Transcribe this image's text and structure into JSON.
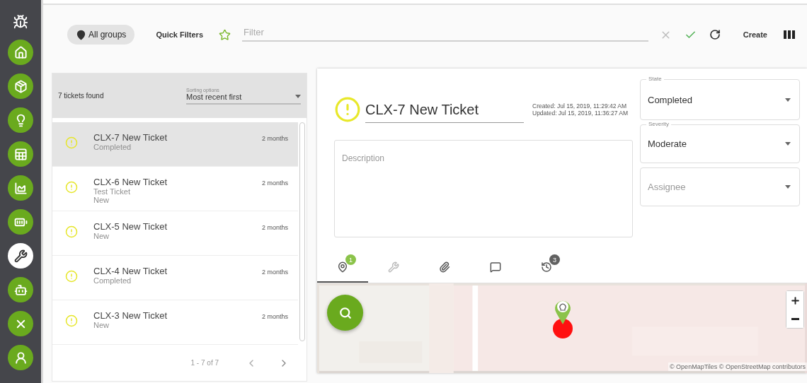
{
  "sidebar": {
    "items": [
      {
        "kind": "home",
        "selected": false
      },
      {
        "kind": "box",
        "selected": false
      },
      {
        "kind": "bulb",
        "selected": false
      },
      {
        "kind": "table",
        "selected": false
      },
      {
        "kind": "chart",
        "selected": false
      },
      {
        "kind": "battery",
        "selected": false
      },
      {
        "kind": "wrench",
        "selected": true
      },
      {
        "kind": "robot",
        "selected": false
      },
      {
        "kind": "drone",
        "selected": false
      },
      {
        "kind": "user",
        "selected": false
      }
    ]
  },
  "toolbar": {
    "group_button": "All groups",
    "quick_filters": "Quick Filters",
    "filter": {
      "placeholder": "Filter"
    },
    "create": "Create"
  },
  "ticket_list": {
    "count": "7 tickets found",
    "sorting": {
      "label": "Sorting options",
      "value": "Most recent first"
    },
    "tickets": [
      {
        "title": "CLX-7 New Ticket",
        "lines": [
          "Completed"
        ],
        "age": "2 months",
        "selected": true
      },
      {
        "title": "CLX-6 New Ticket",
        "lines": [
          "Test Ticket",
          "New"
        ],
        "age": "2 months",
        "selected": false
      },
      {
        "title": "CLX-5 New Ticket",
        "lines": [
          "New"
        ],
        "age": "2 months",
        "selected": false
      },
      {
        "title": "CLX-4 New Ticket",
        "lines": [
          "Completed"
        ],
        "age": "2 months",
        "selected": false
      },
      {
        "title": "CLX-3 New Ticket",
        "lines": [
          "New"
        ],
        "age": "2 months",
        "selected": false
      }
    ],
    "pagination": "1 - 7 of 7"
  },
  "detail": {
    "title": "CLX-7 New Ticket",
    "created": "Created: Jul 15, 2019, 11:29:42 AM",
    "updated": "Updated: Jul 15, 2019, 11:36:27 AM",
    "description": {
      "placeholder": "Description"
    },
    "state": {
      "label": "State",
      "value": "Completed"
    },
    "severity": {
      "label": "Severity",
      "value": "Moderate"
    },
    "assignee": {
      "placeholder": "Assignee"
    },
    "tabs": [
      {
        "kind": "location",
        "badge": "1",
        "color": "#8bc34a",
        "selected": true
      },
      {
        "kind": "wrench",
        "selected": false
      },
      {
        "kind": "attachment",
        "selected": false
      },
      {
        "kind": "comment",
        "selected": false
      },
      {
        "kind": "history",
        "badge": "3",
        "color": "#616161",
        "selected": false
      }
    ],
    "map": {
      "attribution": "© OpenMapTiles © OpenStreetMap contributors"
    }
  }
}
